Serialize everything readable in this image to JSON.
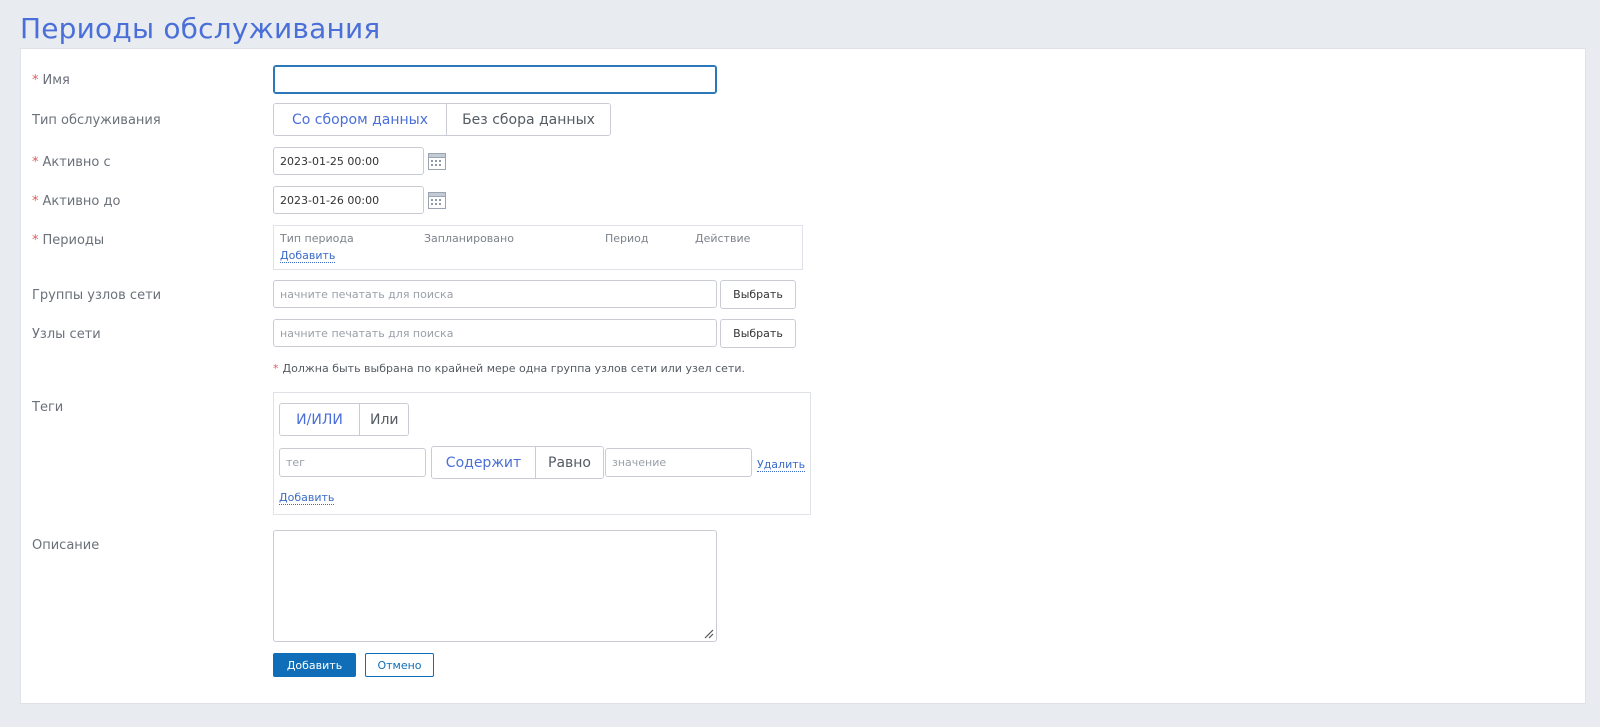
{
  "page": {
    "title": "Периоды обслуживания"
  },
  "form": {
    "name": {
      "label": "Имя",
      "required_mark": "*",
      "value": ""
    },
    "service_type": {
      "label": "Тип обслуживания",
      "options": [
        "Со сбором данных",
        "Без сбора данных"
      ],
      "selected": "Со сбором данных"
    },
    "active_from": {
      "label": "Активно с",
      "required_mark": "*",
      "value": "2023-01-25 00:00"
    },
    "active_to": {
      "label": "Активно до",
      "required_mark": "*",
      "value": "2023-01-26 00:00"
    },
    "periods": {
      "label": "Периоды",
      "required_mark": "*",
      "columns": [
        "Тип периода",
        "Запланировано",
        "Период",
        "Действие"
      ],
      "add_link": "Добавить"
    },
    "host_groups": {
      "label": "Группы узлов сети",
      "placeholder": "начните печатать для поиска",
      "select_button": "Выбрать"
    },
    "hosts": {
      "label": "Узлы сети",
      "placeholder": "начните печатать для поиска",
      "select_button": "Выбрать"
    },
    "hosts_note": {
      "mark": "*",
      "text": "Должна быть выбрана по крайней мере одна группа узлов сети или узел сети."
    },
    "tags": {
      "label": "Теги",
      "evaltype_options": [
        "И/ИЛИ",
        "Или"
      ],
      "evaltype_selected": "И/ИЛИ",
      "rows": [
        {
          "tag_placeholder": "тег",
          "operator_options": [
            "Содержит",
            "Равно"
          ],
          "operator_selected": "Содержит",
          "value_placeholder": "значение",
          "remove_link": "Удалить"
        }
      ],
      "add_link": "Добавить"
    },
    "description": {
      "label": "Описание",
      "value": ""
    },
    "buttons": {
      "submit": "Добавить",
      "cancel": "Отмено"
    }
  },
  "colors": {
    "title": "#4b6fd8",
    "active_segment": "#4b6fd8",
    "required": "#e05a5a",
    "link": "#3b6bc7",
    "primary": "#0f6eb7",
    "background": "#e8ecf0"
  },
  "icons": {
    "calendar": "calendar-icon",
    "resize": "resize-handle-icon"
  }
}
